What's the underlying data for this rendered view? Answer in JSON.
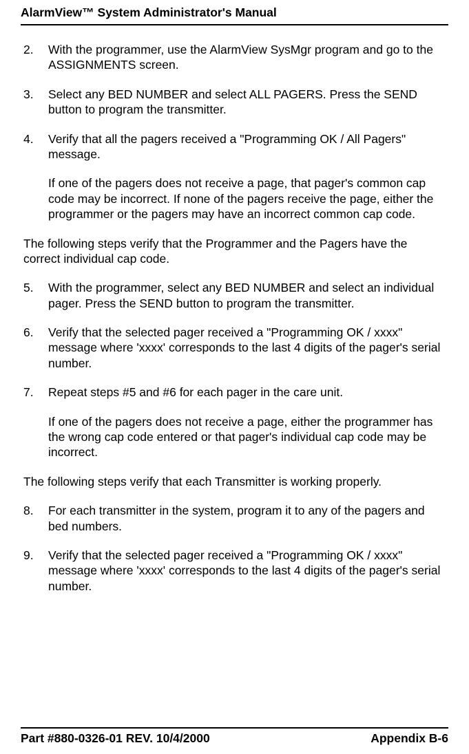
{
  "header": {
    "title": "AlarmView™ System Administrator's Manual"
  },
  "steps": {
    "s2": {
      "num": "2.",
      "text": "With the programmer, use the AlarmView SysMgr program and go to the ASSIGNMENTS screen."
    },
    "s3": {
      "num": "3.",
      "text": "Select any BED NUMBER and select ALL PAGERS.  Press the SEND button to program the transmitter."
    },
    "s4": {
      "num": "4.",
      "text": "Verify that all the pagers received a \"Programming OK / All Pagers\" message.",
      "sub": "If one of the pagers does not receive a page, that pager's common cap code may be incorrect.  If none of the pagers receive the page, either the programmer or the pagers may have an incorrect common cap code."
    },
    "intro1": "The following steps verify that the Programmer and the Pagers have the correct individual cap code.",
    "s5": {
      "num": "5.",
      "text": "With the programmer, select any BED NUMBER and select an individual pager.  Press the SEND button to program the transmitter."
    },
    "s6": {
      "num": "6.",
      "text": "Verify that the selected pager received a \"Programming OK / xxxx\" message where 'xxxx' corresponds to the last 4 digits of the pager's serial number."
    },
    "s7": {
      "num": "7.",
      "text": "Repeat steps #5 and #6 for each pager in the care unit.",
      "sub": "If one of the pagers does not receive a page, either the programmer has the wrong cap code entered or that pager's individual cap code may be incorrect."
    },
    "intro2": "The following steps verify that each Transmitter is working properly.",
    "s8": {
      "num": "8.",
      "text": "For each transmitter in the system, program it to any of the pagers and bed numbers."
    },
    "s9": {
      "num": "9.",
      "text": "Verify that the selected pager received a \"Programming OK / xxxx\" message where 'xxxx' corresponds to the last 4 digits of the pager's serial number."
    }
  },
  "footer": {
    "left": "Part #880-0326-01 REV. 10/4/2000",
    "right": "Appendix B-6"
  }
}
